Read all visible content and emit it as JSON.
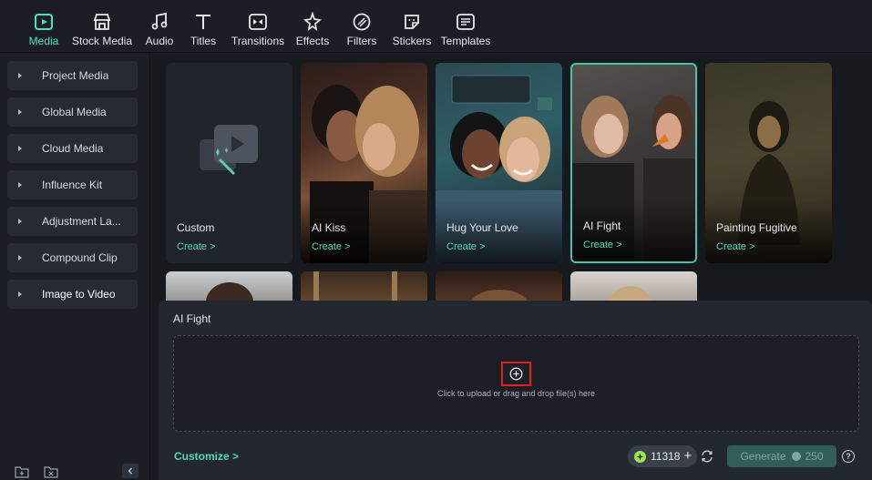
{
  "toolbar": {
    "items": [
      {
        "label": "Media",
        "icon": "media-icon",
        "active": true
      },
      {
        "label": "Stock Media",
        "icon": "stock-media-icon"
      },
      {
        "label": "Audio",
        "icon": "audio-icon"
      },
      {
        "label": "Titles",
        "icon": "titles-icon"
      },
      {
        "label": "Transitions",
        "icon": "transitions-icon"
      },
      {
        "label": "Effects",
        "icon": "effects-icon"
      },
      {
        "label": "Filters",
        "icon": "filters-icon"
      },
      {
        "label": "Stickers",
        "icon": "stickers-icon"
      },
      {
        "label": "Templates",
        "icon": "templates-icon"
      }
    ]
  },
  "sidebar": {
    "items": [
      {
        "label": "Project Media"
      },
      {
        "label": "Global Media"
      },
      {
        "label": "Cloud Media"
      },
      {
        "label": "Influence Kit"
      },
      {
        "label": "Adjustment La..."
      },
      {
        "label": "Compound Clip"
      },
      {
        "label": "Image to Video"
      }
    ]
  },
  "gallery": {
    "cards": [
      {
        "name": "Custom",
        "action": "Create >"
      },
      {
        "name": "AI Kiss",
        "action": "Create >"
      },
      {
        "name": "Hug Your Love",
        "action": "Create >"
      },
      {
        "name": "AI Fight",
        "action": "Create >"
      },
      {
        "name": "Painting Fugitive",
        "action": "Create >"
      }
    ]
  },
  "panel": {
    "title": "AI Fight",
    "upload_hint": "Click to upload or drag and drop file(s) here",
    "customize": "Customize >",
    "credits": "11318",
    "generate_label": "Generate",
    "generate_cost": "250",
    "help": "?"
  },
  "colors": {
    "accent": "#4fd6b6",
    "highlight_box": "#e01f1f",
    "generate_bg": "#2f5f57"
  }
}
